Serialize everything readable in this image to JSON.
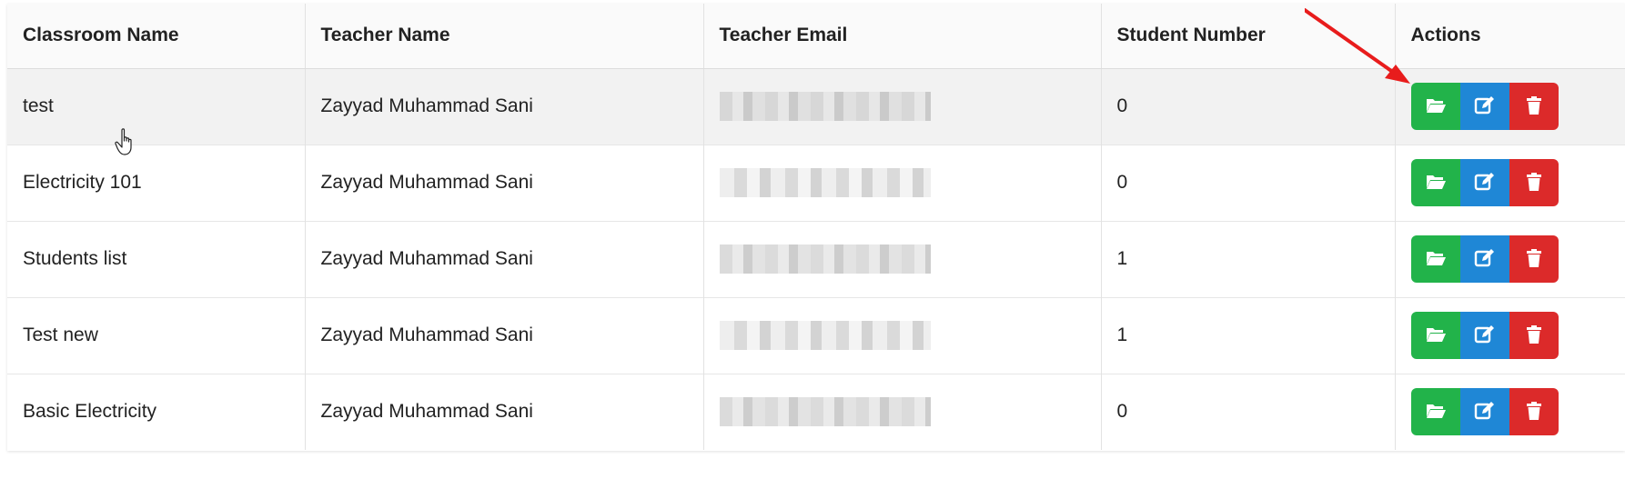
{
  "table": {
    "headers": [
      "Classroom Name",
      "Teacher Name",
      "Teacher Email",
      "Student Number",
      "Actions"
    ],
    "rows": [
      {
        "classroom": "test",
        "teacher": "Zayyad Muhammad Sani",
        "students": "0"
      },
      {
        "classroom": "Electricity 101",
        "teacher": "Zayyad Muhammad Sani",
        "students": "0"
      },
      {
        "classroom": "Students list",
        "teacher": "Zayyad Muhammad Sani",
        "students": "1"
      },
      {
        "classroom": "Test new",
        "teacher": "Zayyad Muhammad Sani",
        "students": "1"
      },
      {
        "classroom": "Basic Electricity",
        "teacher": "Zayyad Muhammad Sani",
        "students": "0"
      }
    ]
  },
  "icons": {
    "view": "folder-open-icon",
    "edit": "edit-icon",
    "delete": "trash-icon"
  },
  "colors": {
    "view_button": "#22b34a",
    "edit_button": "#1f87d6",
    "delete_button": "#dc2a2a",
    "annotation_arrow": "#e81c1c"
  }
}
